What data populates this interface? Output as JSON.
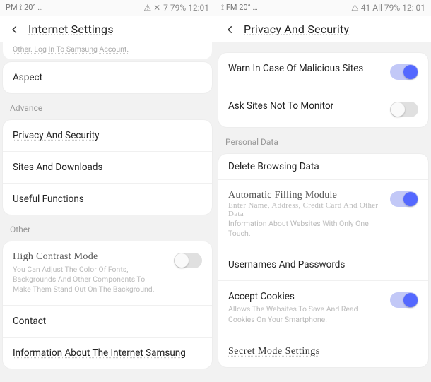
{
  "left": {
    "status": {
      "left": "PM  ⟟  20°  …",
      "right_a": "⚠ ✕",
      "right_b": "7 79% 12:01"
    },
    "header": {
      "title": "Internet Settings"
    },
    "hint": "Other. Log In To Samsung Account.",
    "sections": {
      "group1": {
        "aspect": "Aspect"
      },
      "advance_label": "Advance",
      "advance": {
        "privacy": "Privacy And Security",
        "sites": "Sites And Downloads",
        "useful": "Useful Functions"
      },
      "other_label": "Other",
      "other": {
        "hc_title": "High Contrast Mode",
        "hc_sub": "You Can Adjust The Color Of Fonts, Backgrounds And Other Components To Make Them Stand Out On The Background.",
        "contact": "Contact",
        "info": "Information About The Internet Samsung"
      }
    }
  },
  "right": {
    "status": {
      "left": "⟟  FM  20°  …",
      "right_a": "⚠ 41 All 79% 12: 01"
    },
    "header": {
      "title": "Privacy And Security"
    },
    "top": {
      "warn": {
        "label": "Warn In Case Of Malicious Sites",
        "on": true
      },
      "dnt": {
        "label": "Ask Sites Not To Monitor",
        "on": false
      }
    },
    "pd_label": "Personal Data",
    "pd": {
      "delete": "Delete Browsing Data",
      "autofill_title": "Automatic Filling Module",
      "autofill_sub1": "Enter Name, Address, Credit Card And Other Data",
      "autofill_sub2": "Information About Websites With Only One Touch.",
      "autofill_on": true,
      "usernames": "Usernames And Passwords",
      "cookies_title": "Accept Cookies",
      "cookies_sub": "Allows The Websites To Save And Read Cookies On Your Smartphone.",
      "cookies_on": true,
      "secret": "Secret Mode Settings"
    }
  }
}
